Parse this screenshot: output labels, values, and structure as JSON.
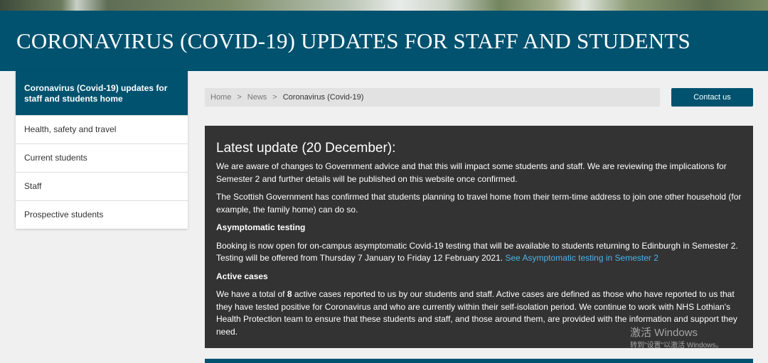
{
  "banner": {
    "title": "CORONAVIRUS (COVID-19) UPDATES FOR STAFF AND STUDENTS"
  },
  "sidebar": {
    "home": "Coronavirus (Covid-19) updates for staff and students home",
    "items": [
      {
        "label": "Health, safety and travel"
      },
      {
        "label": "Current students"
      },
      {
        "label": "Staff"
      },
      {
        "label": "Prospective students"
      }
    ]
  },
  "breadcrumb": {
    "items": [
      "Home",
      "News",
      "Coronavirus (Covid-19)"
    ],
    "separator": ">"
  },
  "contact_button": "Contact us",
  "update": {
    "heading": "Latest update (20 December):",
    "p1": "We are aware of changes to Government advice and that this will impact some students and staff. We are reviewing the implications for Semester 2 and further details will be published on this website once confirmed.",
    "p2": "The Scottish Government has confirmed that students planning to travel home from their term-time address to join one other household (for example, the family home) can do so.",
    "testing_heading": "Asymptomatic testing",
    "testing_text": "Booking is now open for on-campus asymptomatic Covid-19 testing that will be available to students returning to Edinburgh in Semester 2. Testing will be offered from Thursday 7 January to Friday 12 February 2021.",
    "testing_link": "See Asymptomatic testing in Semester 2",
    "active_heading": "Active cases",
    "active_before": "We have a total of ",
    "active_count": "8",
    "active_after": " active cases reported to us by our students and staff. Active cases are defined as those who have reported to us that they have tested positive for Coronavirus and who are currently within their self-isolation period. We continue to work with NHS Lothian's Health Protection team to ensure that these students and staff, and those around them, are provided with the information and support they need."
  },
  "watermark": {
    "line1": "激活 Windows",
    "line2": "转到\"设置\"以激活 Windows。"
  },
  "colors": {
    "brand": "#00526f",
    "panel": "#333333",
    "link": "#4fb3e8"
  }
}
